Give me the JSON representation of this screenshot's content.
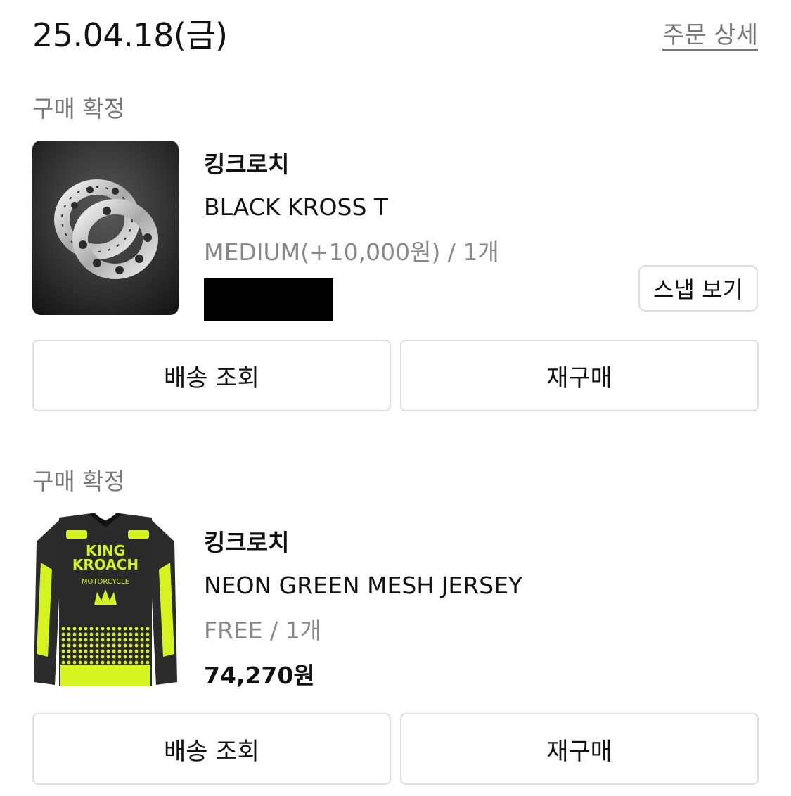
{
  "header": {
    "date": "25.04.18(금)",
    "detail_link": "주문 상세"
  },
  "orders": [
    {
      "status": "구매 확정",
      "brand": "킹크로치",
      "product_name": "BLACK KROSS T",
      "option": "MEDIUM(+10,000원) / 1개",
      "image_alt": "silver ring pair",
      "snap_button": "스냅 보기",
      "buttons": [
        "배송 조회",
        "재구매"
      ]
    },
    {
      "status": "구매 확정",
      "brand": "킹크로치",
      "product_name": "NEON GREEN MESH JERSEY",
      "option": "FREE / 1개",
      "price": "74,270원",
      "image_alt": "neon green mesh jersey",
      "jersey_print": [
        "KING",
        "KROACH",
        "MOTORCYCLE"
      ],
      "buttons": [
        "배송 조회",
        "재구매"
      ]
    }
  ]
}
